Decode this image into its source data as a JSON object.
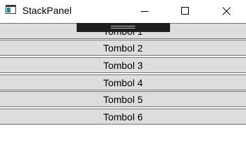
{
  "window": {
    "title": "StackPanel",
    "icons": {
      "app": "app-window-icon",
      "minimize": "minimize-icon",
      "maximize": "maximize-icon",
      "close": "close-icon"
    }
  },
  "stack_panel": {
    "buttons": [
      "Tombol 1",
      "Tombol 2",
      "Tombol 3",
      "Tombol 4",
      "Tombol 5",
      "Tombol 6"
    ]
  },
  "colors": {
    "button_background": "#dddddd",
    "button_border": "#707070",
    "overlay_toolbar": "#1f1f1f"
  }
}
